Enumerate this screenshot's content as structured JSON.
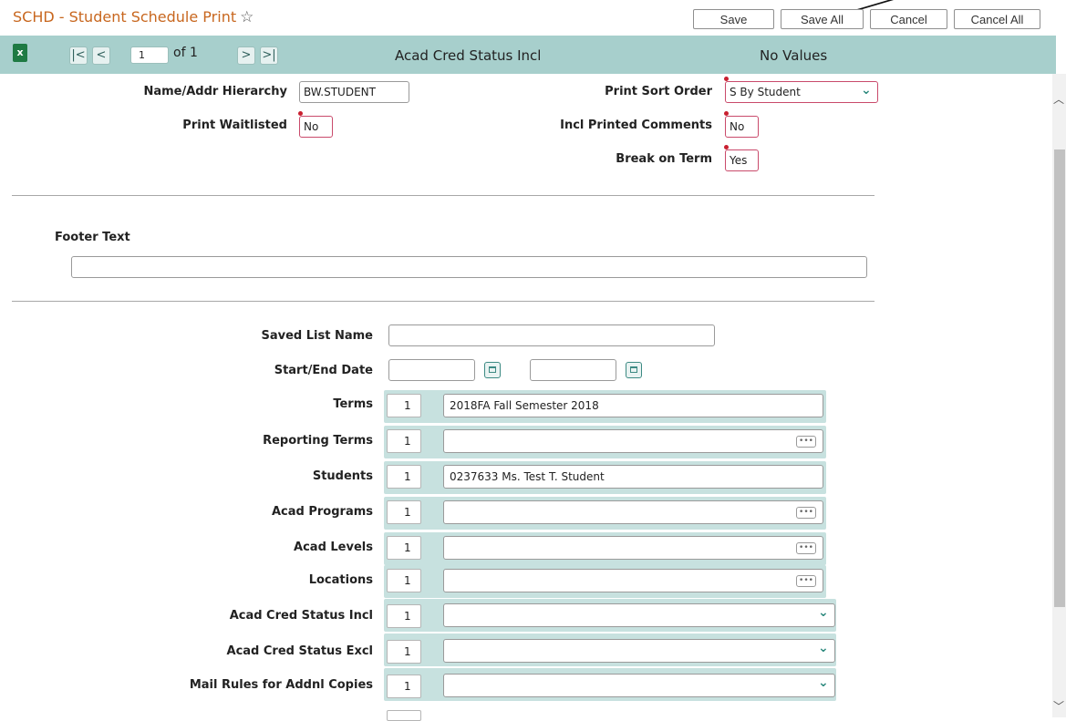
{
  "title": "SCHD - Student Schedule Print",
  "buttons": {
    "save": "Save",
    "save_all": "Save All",
    "cancel": "Cancel",
    "cancel_all": "Cancel All"
  },
  "toolbar": {
    "page_input": "1",
    "page_of": "of 1",
    "center_label": "Acad Cred Status Incl",
    "right_label": "No Values"
  },
  "fields": {
    "name_addr_hierarchy": {
      "label": "Name/Addr Hierarchy",
      "value": "BW.STUDENT"
    },
    "print_sort_order": {
      "label": "Print Sort Order",
      "value": "S  By Student"
    },
    "print_waitlisted": {
      "label": "Print Waitlisted",
      "value": "No"
    },
    "incl_printed_comments": {
      "label": "Incl Printed Comments",
      "value": "No"
    },
    "break_on_term": {
      "label": "Break on Term",
      "value": "Yes"
    },
    "footer_text": {
      "label": "Footer Text",
      "value": ""
    },
    "saved_list_name": {
      "label": "Saved List Name",
      "value": ""
    },
    "start_end_date": {
      "label": "Start/End Date",
      "start": "",
      "end": ""
    }
  },
  "multi_rows": [
    {
      "label": "Terms",
      "num": "1",
      "value": "2018FA Fall Semester 2018",
      "control": "none"
    },
    {
      "label": "Reporting Terms",
      "num": "1",
      "value": "",
      "control": "dots"
    },
    {
      "label": "Students",
      "num": "1",
      "value": "0237633 Ms. Test T. Student",
      "control": "none"
    },
    {
      "label": "Acad Programs",
      "num": "1",
      "value": "",
      "control": "dots"
    },
    {
      "label": "Acad Levels",
      "num": "1",
      "value": "",
      "control": "dots"
    },
    {
      "label": "Locations",
      "num": "1",
      "value": "",
      "control": "dots"
    },
    {
      "label": "Acad Cred Status Incl",
      "num": "1",
      "value": "",
      "control": "dropdown"
    },
    {
      "label": "Acad Cred Status Excl",
      "num": "1",
      "value": "",
      "control": "dropdown"
    },
    {
      "label": "Mail Rules for Addnl Copies",
      "num": "1",
      "value": "",
      "control": "dropdown"
    }
  ],
  "colors": {
    "toolbar": "#a7cfcc",
    "title": "#c8671f",
    "required_border": "#c94a6b",
    "accent": "#2e8a7e"
  }
}
